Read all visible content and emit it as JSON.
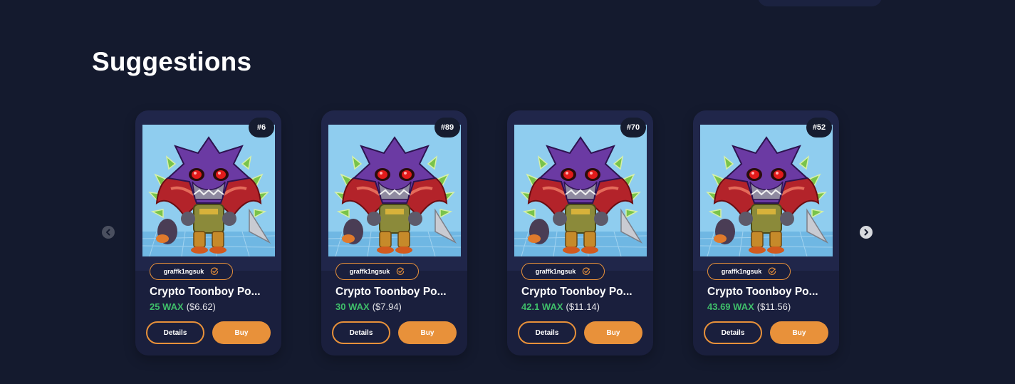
{
  "section_title": "Suggestions",
  "colors": {
    "background": "#141a2e",
    "card": "#1a1f3d",
    "accent": "#e8913a",
    "wax_price": "#3fbf6a"
  },
  "carousel": {
    "prev_icon": "chevron-left-icon",
    "next_icon": "chevron-right-icon"
  },
  "cards": [
    {
      "mint": "#6",
      "creator": "graffk1ngsuk",
      "name": "Crypto Toonboy Po...",
      "price_wax": "25 WAX",
      "price_usd": "($6.62)",
      "details_label": "Details",
      "buy_label": "Buy"
    },
    {
      "mint": "#89",
      "creator": "graffk1ngsuk",
      "name": "Crypto Toonboy Po...",
      "price_wax": "30 WAX",
      "price_usd": "($7.94)",
      "details_label": "Details",
      "buy_label": "Buy"
    },
    {
      "mint": "#70",
      "creator": "graffk1ngsuk",
      "name": "Crypto Toonboy Po...",
      "price_wax": "42.1 WAX",
      "price_usd": "($11.14)",
      "details_label": "Details",
      "buy_label": "Buy"
    },
    {
      "mint": "#52",
      "creator": "graffk1ngsuk",
      "name": "Crypto Toonboy Po...",
      "price_wax": "43.69 WAX",
      "price_usd": "($11.56)",
      "details_label": "Details",
      "buy_label": "Buy"
    }
  ]
}
